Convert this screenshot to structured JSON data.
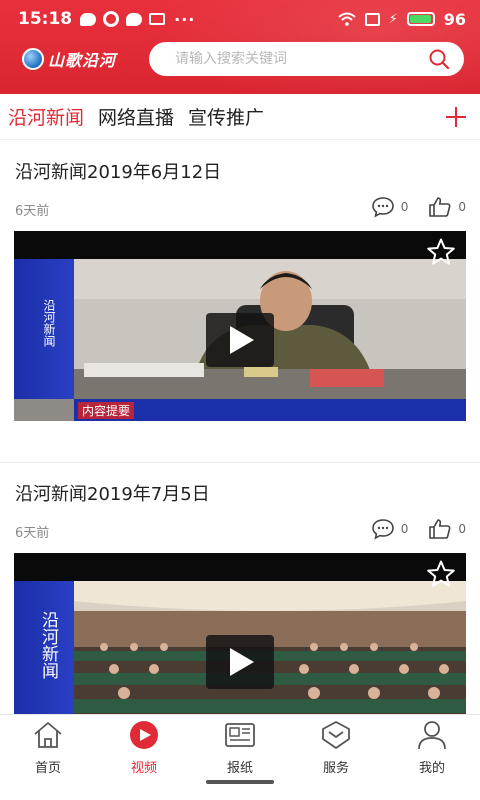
{
  "status_bar": {
    "time": "15:18",
    "more": "···",
    "battery_percent": "96",
    "battery_level": 0.96
  },
  "header": {
    "logo_text": "山歌沿河",
    "search_placeholder": "请输入搜索关键词",
    "brand_color": "#e02a35"
  },
  "tabs": [
    {
      "label": "沿河新闻",
      "active": true
    },
    {
      "label": "网络直播",
      "active": false
    },
    {
      "label": "宣传推广",
      "active": false
    }
  ],
  "feed": [
    {
      "title": "沿河新闻2019年6月12日",
      "time": "6天前",
      "comments": "0",
      "likes": "0",
      "overlay_side_text": "沿河新闻",
      "overlay_caption": "内容提要"
    },
    {
      "title": "沿河新闻2019年7月5日",
      "time": "6天前",
      "comments": "0",
      "likes": "0",
      "overlay_side_text": "沿河新闻"
    }
  ],
  "bottom_nav": [
    {
      "label": "首页",
      "icon": "home-icon",
      "active": false
    },
    {
      "label": "视频",
      "icon": "video-play-icon",
      "active": true
    },
    {
      "label": "报纸",
      "icon": "newspaper-icon",
      "active": false
    },
    {
      "label": "服务",
      "icon": "service-icon",
      "active": false
    },
    {
      "label": "我的",
      "icon": "user-icon",
      "active": false
    }
  ]
}
